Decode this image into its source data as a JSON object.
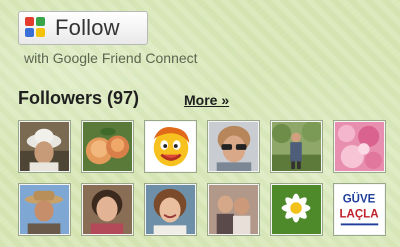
{
  "follow_button": {
    "label": "Follow",
    "icon": "google-friend-connect-icon"
  },
  "caption": "with Google Friend Connect",
  "followers": {
    "title": "Followers (97)",
    "more_link": "More »"
  },
  "avatars": [
    {
      "name": "avatar-follower-1",
      "depicts": "person-with-white-hat"
    },
    {
      "name": "avatar-follower-2",
      "depicts": "peaches"
    },
    {
      "name": "avatar-follower-3",
      "depicts": "cartoon-smiley"
    },
    {
      "name": "avatar-follower-4",
      "depicts": "woman-with-sunglasses"
    },
    {
      "name": "avatar-follower-5",
      "depicts": "person-in-garden"
    },
    {
      "name": "avatar-follower-6",
      "depicts": "pink-flowers"
    },
    {
      "name": "avatar-follower-7",
      "depicts": "man-with-hat"
    },
    {
      "name": "avatar-follower-8",
      "depicts": "woman-portrait"
    },
    {
      "name": "avatar-follower-9",
      "depicts": "smiling-woman"
    },
    {
      "name": "avatar-follower-10",
      "depicts": "couple-photo"
    },
    {
      "name": "avatar-follower-11",
      "depicts": "white-daisy"
    },
    {
      "name": "avatar-follower-12",
      "depicts": "logo"
    }
  ],
  "avatar_12_logo_text": [
    "GÜVE",
    "LAÇLA"
  ],
  "colors": {
    "background": "#d9e8b8",
    "text": "#1f1f1f",
    "caption": "#5a6650"
  }
}
